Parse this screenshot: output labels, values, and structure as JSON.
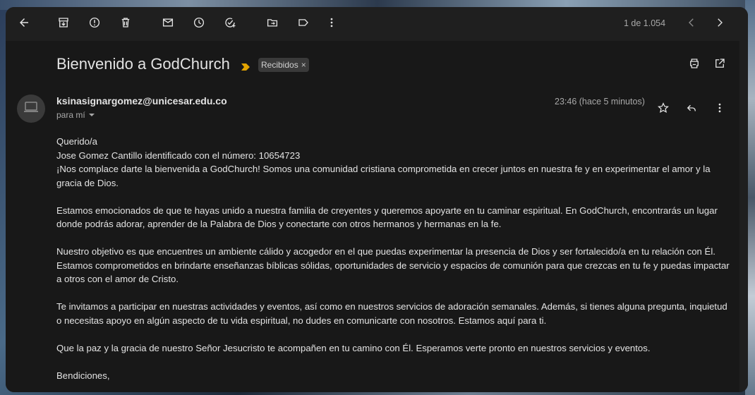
{
  "toolbar": {
    "back_icon": "arrow-left-icon",
    "archive_icon": "archive-icon",
    "report_icon": "report-spam-icon",
    "delete_icon": "trash-icon",
    "unread_icon": "mail-icon",
    "snooze_icon": "clock-icon",
    "task_icon": "add-task-icon",
    "move_icon": "folder-move-icon",
    "label_icon": "label-icon",
    "more_icon": "more-vert-icon",
    "counter": "1 de 1.054",
    "prev_icon": "chevron-left-icon",
    "next_icon": "chevron-right-icon"
  },
  "email": {
    "subject": "Bienvenido a GodChurch",
    "label": "Recibidos",
    "label_remove": "×",
    "sender": "ksinasignargomez@unicesar.edu.co",
    "recipient": "para mí",
    "time": "23:46 (hace 5 minutos)",
    "body": [
      "Querido/a",
      "Jose Gomez Cantillo identificado con el número: 10654723",
      "¡Nos complace darte la bienvenida a GodChurch! Somos una comunidad cristiana comprometida en crecer juntos en nuestra fe y en experimentar el amor y la gracia de Dios.",
      "Estamos emocionados de que te hayas unido a nuestra familia de creyentes y queremos apoyarte en tu caminar espiritual. En GodChurch, encontrarás un lugar donde podrás adorar, aprender de la Palabra de Dios y conectarte con otros hermanos y hermanas en la fe.",
      "Nuestro objetivo es que encuentres un ambiente cálido y acogedor en el que puedas experimentar la presencia de Dios y ser fortalecido/a en tu relación con Él. Estamos comprometidos en brindarte enseñanzas bíblicas sólidas, oportunidades de servicio y espacios de comunión para que crezcas en tu fe y puedas impactar a otros con el amor de Cristo.",
      "Te invitamos a participar en nuestras actividades y eventos, así como en nuestros servicios de adoración semanales. Además, si tienes alguna pregunta, inquietud o necesitas apoyo en algún aspecto de tu vida espiritual, no dudes en comunicarte con nosotros. Estamos aquí para ti.",
      "Que la paz y la gracia de nuestro Señor Jesucristo te acompañen en tu camino con Él. Esperamos verte pronto en nuestros servicios y eventos.",
      "Bendiciones,"
    ]
  },
  "colors": {
    "window_bg": "#1f1f1f",
    "content_bg": "#181818",
    "text_primary": "#e3e3e3",
    "text_secondary": "#a8a8a8",
    "importance_marker": "#e3a400"
  }
}
